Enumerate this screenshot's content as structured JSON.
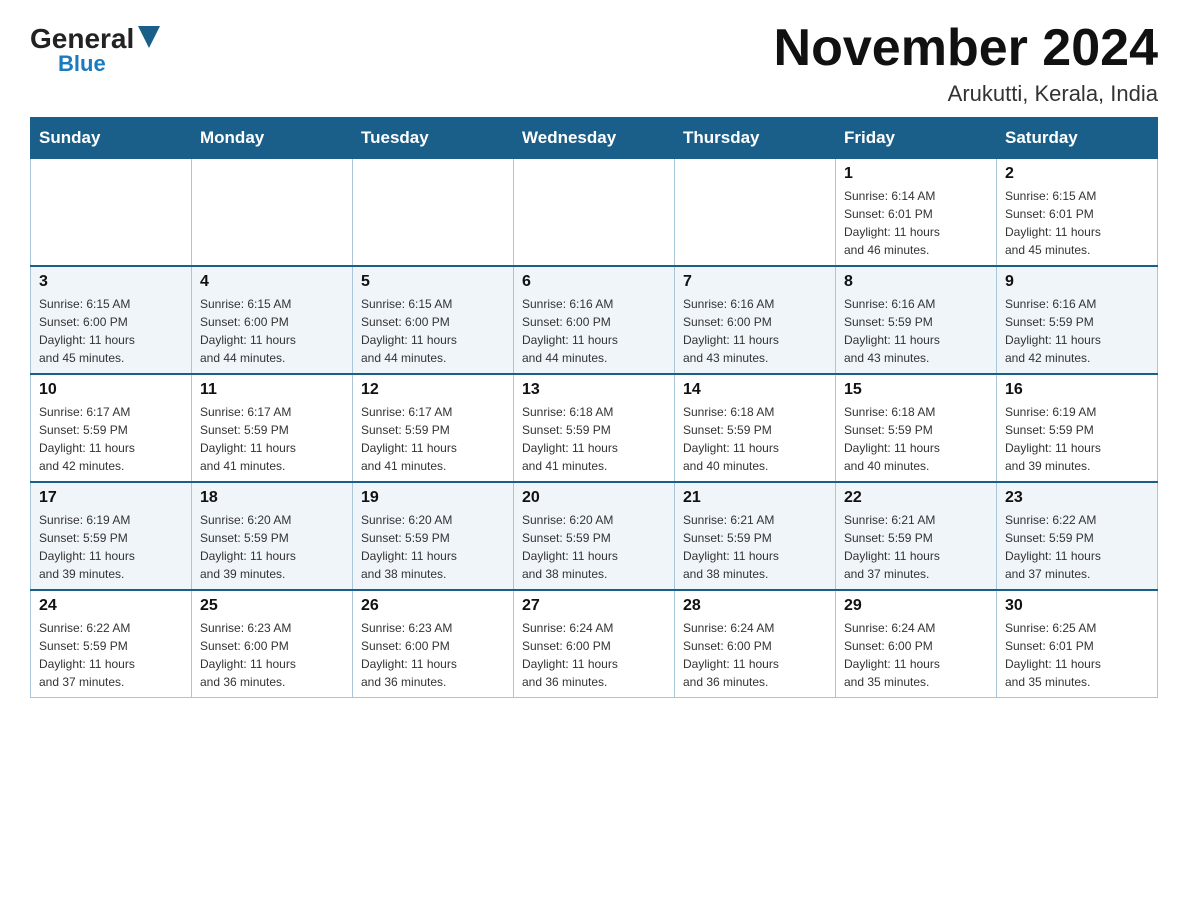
{
  "logo": {
    "general": "General",
    "blue": "Blue"
  },
  "header": {
    "title": "November 2024",
    "subtitle": "Arukutti, Kerala, India"
  },
  "days_of_week": [
    "Sunday",
    "Monday",
    "Tuesday",
    "Wednesday",
    "Thursday",
    "Friday",
    "Saturday"
  ],
  "weeks": [
    [
      {
        "day": "",
        "info": ""
      },
      {
        "day": "",
        "info": ""
      },
      {
        "day": "",
        "info": ""
      },
      {
        "day": "",
        "info": ""
      },
      {
        "day": "",
        "info": ""
      },
      {
        "day": "1",
        "info": "Sunrise: 6:14 AM\nSunset: 6:01 PM\nDaylight: 11 hours\nand 46 minutes."
      },
      {
        "day": "2",
        "info": "Sunrise: 6:15 AM\nSunset: 6:01 PM\nDaylight: 11 hours\nand 45 minutes."
      }
    ],
    [
      {
        "day": "3",
        "info": "Sunrise: 6:15 AM\nSunset: 6:00 PM\nDaylight: 11 hours\nand 45 minutes."
      },
      {
        "day": "4",
        "info": "Sunrise: 6:15 AM\nSunset: 6:00 PM\nDaylight: 11 hours\nand 44 minutes."
      },
      {
        "day": "5",
        "info": "Sunrise: 6:15 AM\nSunset: 6:00 PM\nDaylight: 11 hours\nand 44 minutes."
      },
      {
        "day": "6",
        "info": "Sunrise: 6:16 AM\nSunset: 6:00 PM\nDaylight: 11 hours\nand 44 minutes."
      },
      {
        "day": "7",
        "info": "Sunrise: 6:16 AM\nSunset: 6:00 PM\nDaylight: 11 hours\nand 43 minutes."
      },
      {
        "day": "8",
        "info": "Sunrise: 6:16 AM\nSunset: 5:59 PM\nDaylight: 11 hours\nand 43 minutes."
      },
      {
        "day": "9",
        "info": "Sunrise: 6:16 AM\nSunset: 5:59 PM\nDaylight: 11 hours\nand 42 minutes."
      }
    ],
    [
      {
        "day": "10",
        "info": "Sunrise: 6:17 AM\nSunset: 5:59 PM\nDaylight: 11 hours\nand 42 minutes."
      },
      {
        "day": "11",
        "info": "Sunrise: 6:17 AM\nSunset: 5:59 PM\nDaylight: 11 hours\nand 41 minutes."
      },
      {
        "day": "12",
        "info": "Sunrise: 6:17 AM\nSunset: 5:59 PM\nDaylight: 11 hours\nand 41 minutes."
      },
      {
        "day": "13",
        "info": "Sunrise: 6:18 AM\nSunset: 5:59 PM\nDaylight: 11 hours\nand 41 minutes."
      },
      {
        "day": "14",
        "info": "Sunrise: 6:18 AM\nSunset: 5:59 PM\nDaylight: 11 hours\nand 40 minutes."
      },
      {
        "day": "15",
        "info": "Sunrise: 6:18 AM\nSunset: 5:59 PM\nDaylight: 11 hours\nand 40 minutes."
      },
      {
        "day": "16",
        "info": "Sunrise: 6:19 AM\nSunset: 5:59 PM\nDaylight: 11 hours\nand 39 minutes."
      }
    ],
    [
      {
        "day": "17",
        "info": "Sunrise: 6:19 AM\nSunset: 5:59 PM\nDaylight: 11 hours\nand 39 minutes."
      },
      {
        "day": "18",
        "info": "Sunrise: 6:20 AM\nSunset: 5:59 PM\nDaylight: 11 hours\nand 39 minutes."
      },
      {
        "day": "19",
        "info": "Sunrise: 6:20 AM\nSunset: 5:59 PM\nDaylight: 11 hours\nand 38 minutes."
      },
      {
        "day": "20",
        "info": "Sunrise: 6:20 AM\nSunset: 5:59 PM\nDaylight: 11 hours\nand 38 minutes."
      },
      {
        "day": "21",
        "info": "Sunrise: 6:21 AM\nSunset: 5:59 PM\nDaylight: 11 hours\nand 38 minutes."
      },
      {
        "day": "22",
        "info": "Sunrise: 6:21 AM\nSunset: 5:59 PM\nDaylight: 11 hours\nand 37 minutes."
      },
      {
        "day": "23",
        "info": "Sunrise: 6:22 AM\nSunset: 5:59 PM\nDaylight: 11 hours\nand 37 minutes."
      }
    ],
    [
      {
        "day": "24",
        "info": "Sunrise: 6:22 AM\nSunset: 5:59 PM\nDaylight: 11 hours\nand 37 minutes."
      },
      {
        "day": "25",
        "info": "Sunrise: 6:23 AM\nSunset: 6:00 PM\nDaylight: 11 hours\nand 36 minutes."
      },
      {
        "day": "26",
        "info": "Sunrise: 6:23 AM\nSunset: 6:00 PM\nDaylight: 11 hours\nand 36 minutes."
      },
      {
        "day": "27",
        "info": "Sunrise: 6:24 AM\nSunset: 6:00 PM\nDaylight: 11 hours\nand 36 minutes."
      },
      {
        "day": "28",
        "info": "Sunrise: 6:24 AM\nSunset: 6:00 PM\nDaylight: 11 hours\nand 36 minutes."
      },
      {
        "day": "29",
        "info": "Sunrise: 6:24 AM\nSunset: 6:00 PM\nDaylight: 11 hours\nand 35 minutes."
      },
      {
        "day": "30",
        "info": "Sunrise: 6:25 AM\nSunset: 6:01 PM\nDaylight: 11 hours\nand 35 minutes."
      }
    ]
  ]
}
